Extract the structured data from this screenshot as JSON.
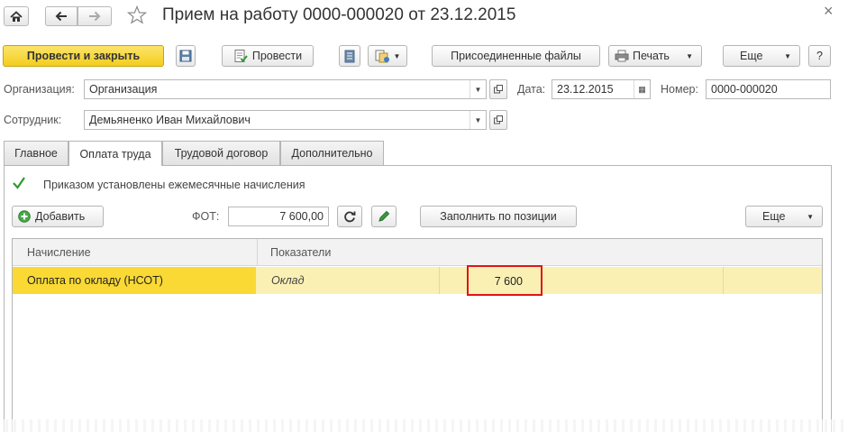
{
  "window": {
    "title": "Прием на работу 0000-000020 от 23.12.2015",
    "close_glyph": "×"
  },
  "toolbar": {
    "post_and_close": "Провести и закрыть",
    "post": "Провести",
    "attached_files": "Присоединенные файлы",
    "print": "Печать",
    "more": "Еще",
    "help": "?"
  },
  "form": {
    "organization_label": "Организация:",
    "organization_value": "Организация",
    "date_label": "Дата:",
    "date_value": "23.12.2015",
    "number_label": "Номер:",
    "number_value": "0000-000020",
    "employee_label": "Сотрудник:",
    "employee_value": "Демьяненко Иван Михайлович"
  },
  "tabs": [
    {
      "label": "Главное"
    },
    {
      "label": "Оплата труда"
    },
    {
      "label": "Трудовой договор"
    },
    {
      "label": "Дополнительно"
    }
  ],
  "pay_tab": {
    "checkbox_label": "Приказом установлены ежемесячные начисления",
    "checkbox_checked": true,
    "add_button": "Добавить",
    "fot_label": "ФОТ:",
    "fot_value": "7 600,00",
    "fill_by_position": "Заполнить по позиции",
    "more": "Еще"
  },
  "grid": {
    "columns": [
      "Начисление",
      "Показатели"
    ],
    "rows": [
      {
        "accrual": "Оплата по окладу (НСОТ)",
        "indicator": "Оклад",
        "value": "7 600"
      }
    ]
  },
  "colors": {
    "primary_button": "#f4cd1f",
    "selected_row": "#fbf0b4",
    "selected_cell": "#fad934",
    "highlight_box": "#e0141b",
    "checkmark": "#2f9a2f"
  }
}
